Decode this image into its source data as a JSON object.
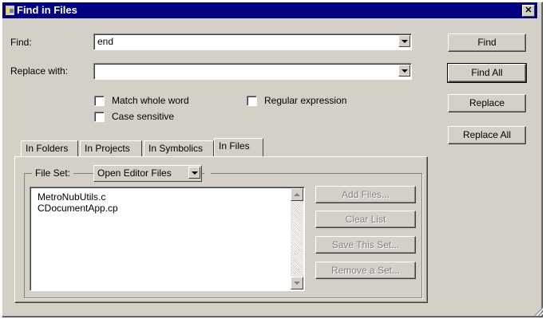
{
  "window": {
    "title": "Find in Files"
  },
  "find": {
    "label": "Find:",
    "value": "end"
  },
  "replace": {
    "label": "Replace with:",
    "value": ""
  },
  "options": {
    "match_whole_word": {
      "label": "Match whole word",
      "checked": false
    },
    "case_sensitive": {
      "label": "Case sensitive",
      "checked": false
    },
    "regular_expression": {
      "label": "Regular expression",
      "checked": false
    }
  },
  "buttons": {
    "find": "Find",
    "find_all": "Find All",
    "replace": "Replace",
    "replace_all": "Replace All"
  },
  "tabs": [
    {
      "label": "In Folders",
      "active": false
    },
    {
      "label": "In Projects",
      "active": false
    },
    {
      "label": "In Symbolics",
      "active": false
    },
    {
      "label": "In Files",
      "active": true
    }
  ],
  "file_set": {
    "label": "File Set:",
    "value": "Open Editor Files"
  },
  "files": [
    "MetroNubUtils.c",
    "CDocumentApp.cp"
  ],
  "file_buttons": {
    "add_files": "Add Files...",
    "clear_list": "Clear List",
    "save_set": "Save This Set...",
    "remove_set": "Remove a Set..."
  }
}
